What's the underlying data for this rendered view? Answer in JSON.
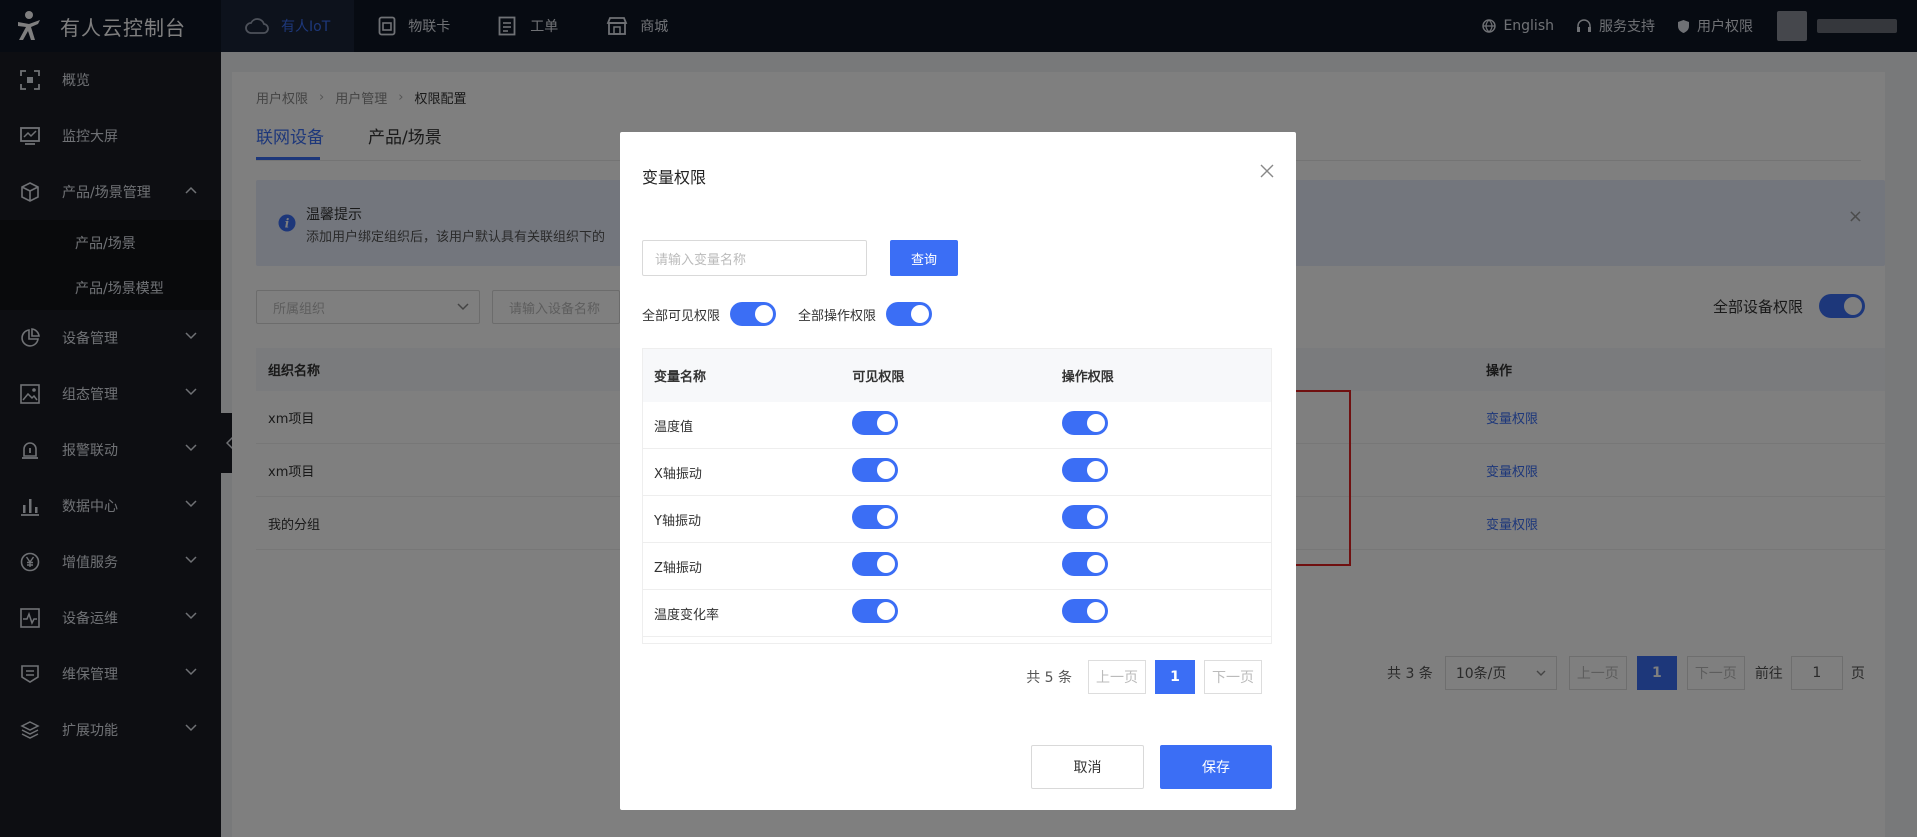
{
  "app": {
    "title": "有人云控制台"
  },
  "nav": [
    {
      "label": "有人IoT",
      "icon": "cloud-icon",
      "active": true
    },
    {
      "label": "物联卡",
      "icon": "sim-card-icon"
    },
    {
      "label": "工单",
      "icon": "ticket-icon"
    },
    {
      "label": "商城",
      "icon": "store-icon"
    }
  ],
  "topright": {
    "language": "English",
    "support": "服务支持",
    "user_perm": "用户权限"
  },
  "sidebar": {
    "items": [
      {
        "label": "概览",
        "icon": "overview-icon"
      },
      {
        "label": "监控大屏",
        "icon": "monitor-icon"
      },
      {
        "label": "产品/场景管理",
        "icon": "cube-icon",
        "expanded": true
      },
      {
        "label": "设备管理",
        "icon": "pie-chart-icon"
      },
      {
        "label": "组态管理",
        "icon": "image-icon"
      },
      {
        "label": "报警联动",
        "icon": "alarm-icon"
      },
      {
        "label": "数据中心",
        "icon": "bar-chart-icon"
      },
      {
        "label": "增值服务",
        "icon": "yen-icon"
      },
      {
        "label": "设备运维",
        "icon": "pulse-icon"
      },
      {
        "label": "维保管理",
        "icon": "maintenance-icon"
      },
      {
        "label": "扩展功能",
        "icon": "layers-icon"
      }
    ],
    "subitems": [
      "产品/场景",
      "产品/场景模型"
    ]
  },
  "breadcrumb": [
    "用户权限",
    "用户管理",
    "权限配置"
  ],
  "tabs": [
    "联网设备",
    "产品/场景"
  ],
  "alert": {
    "title": "温馨提示",
    "text": "添加用户绑定组织后，该用户默认具有关联组织下的"
  },
  "filters": {
    "org_placeholder": "所属组织",
    "device_placeholder": "请输入设备名称"
  },
  "device_perm_label": "全部设备权限",
  "table": {
    "headers": [
      "组织名称",
      "操作"
    ],
    "rows": [
      {
        "name": "xm项目",
        "action": "变量权限"
      },
      {
        "name": "xm项目",
        "action": "变量权限"
      },
      {
        "name": "我的分组",
        "action": "变量权限"
      }
    ]
  },
  "pager": {
    "total": "共 3 条",
    "size": "10条/页",
    "prev": "上一页",
    "current": "1",
    "next": "下一页",
    "goto": "前往",
    "goto_value": "1",
    "page_unit": "页"
  },
  "modal": {
    "title": "变量权限",
    "search_placeholder": "请输入变量名称",
    "query_label": "查询",
    "all_visible": "全部可见权限",
    "all_operate": "全部操作权限",
    "headers": [
      "变量名称",
      "可见权限",
      "操作权限"
    ],
    "rows": [
      "温度值",
      "X轴振动",
      "Y轴振动",
      "Z轴振动",
      "温度变化率"
    ],
    "pager": {
      "total": "共 5 条",
      "prev": "上一页",
      "current": "1",
      "next": "下一页"
    },
    "cancel": "取消",
    "save": "保存"
  }
}
